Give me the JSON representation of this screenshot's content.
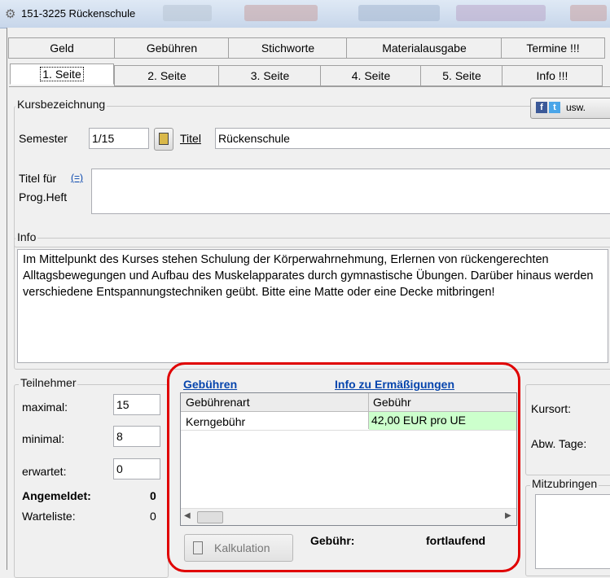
{
  "window": {
    "title": "151-3225 Rückenschule"
  },
  "tabs_top": [
    "Geld",
    "Gebühren",
    "Stichworte",
    "Materialausgabe",
    "Termine !!!"
  ],
  "tabs_bottom": [
    "1. Seite",
    "2. Seite",
    "3. Seite",
    "4. Seite",
    "5. Seite",
    "Info !!!"
  ],
  "kurs": {
    "group_label": "Kursbezeichnung",
    "social_label": "usw.",
    "semester_label": "Semester",
    "semester_value": "1/15",
    "titel_label": "Titel",
    "titel_value": "Rückenschule",
    "titel_fuer_label": "Titel für",
    "titel_fuer_link": "(=)",
    "progheft_label": "Prog.Heft"
  },
  "info": {
    "group_label": "Info",
    "text": "Im Mittelpunkt des Kurses stehen Schulung der Körperwahrnehmung, Erlernen von rückengerechten Alltagsbewegungen und Aufbau des Muskelapparates durch gymnastische Übungen. Darüber hinaus werden verschiedene Entspannungstechniken geübt. Bitte eine Matte oder eine Decke mitbringen!"
  },
  "teilnehmer": {
    "group_label": "Teilnehmer",
    "maximal_label": "maximal:",
    "maximal_value": "15",
    "minimal_label": "minimal:",
    "minimal_value": "8",
    "erwartet_label": "erwartet:",
    "erwartet_value": "0",
    "angemeldet_label": "Angemeldet:",
    "angemeldet_value": "0",
    "warteliste_label": "Warteliste:",
    "warteliste_value": "0"
  },
  "gebuehren": {
    "link_gebuehren": "Gebühren",
    "link_ermaessigungen": "Info zu Ermäßigungen",
    "col_art": "Gebührenart",
    "col_gebuehr": "Gebühr",
    "rows": [
      {
        "art": "Kerngebühr",
        "gebuehr": "42,00 EUR pro UE"
      }
    ],
    "kalkulation_label": "Kalkulation",
    "gebuehr_label": "Gebühr:",
    "gebuehr_value": "fortlaufend",
    "highlight_color": "#e00000",
    "cell_highlight_color": "#ccffcc"
  },
  "right": {
    "kursort_label": "Kursort:",
    "abw_tage_label": "Abw. Tage:",
    "mitzubringen_label": "Mitzubringen"
  }
}
